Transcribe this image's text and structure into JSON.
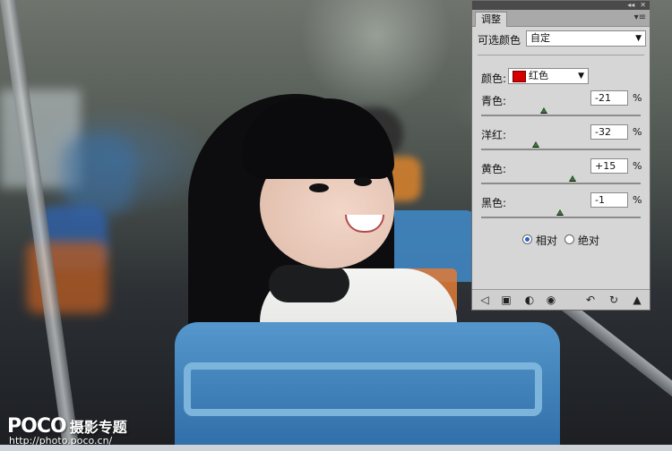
{
  "panel": {
    "tab_label": "调整",
    "menu_icon": "▾≡",
    "top_controls": [
      "◂◂",
      "✕"
    ],
    "preset_label": "可选颜色",
    "preset_value": "自定",
    "colors_label": "颜色:",
    "color_value": "红色",
    "color_swatch": "#d40000",
    "sliders": [
      {
        "label": "青色:",
        "value": "-21",
        "unit": "%",
        "position": -21
      },
      {
        "label": "洋红:",
        "value": "-32",
        "unit": "%",
        "position": -32
      },
      {
        "label": "黄色:",
        "value": "+15",
        "unit": "%",
        "position": 15
      },
      {
        "label": "黑色:",
        "value": "-1",
        "unit": "%",
        "position": -1
      }
    ],
    "mode_relative": "相对",
    "mode_absolute": "绝对",
    "selected_mode": "relative",
    "toolbar_icons": [
      "back-arrow-icon",
      "clip-to-layer-icon",
      "layer-visibility-circle-icon",
      "eye-icon",
      "view-previous-icon",
      "reset-icon",
      "trash-icon"
    ]
  },
  "watermark": {
    "brand": "POCO",
    "subtitle": "摄影专题",
    "url": "http://photo.poco.cn/"
  }
}
